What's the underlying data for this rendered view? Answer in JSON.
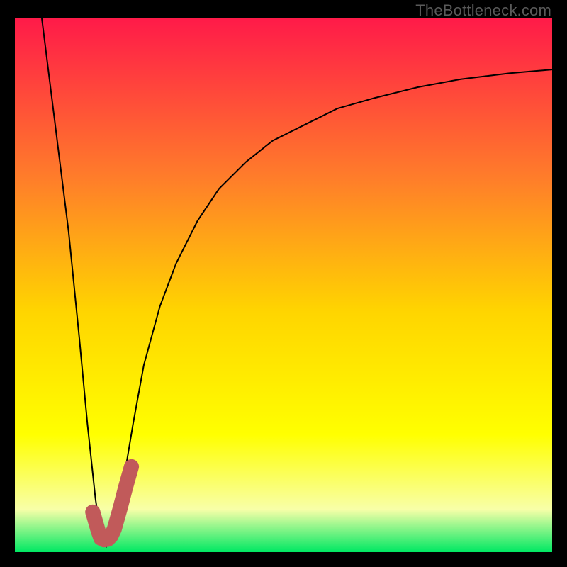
{
  "watermark": "TheBottleneck.com",
  "colors": {
    "frame": "#000000",
    "gradient_top": "#ff1a49",
    "gradient_mid1": "#ff7d2a",
    "gradient_mid2": "#ffd500",
    "gradient_mid3": "#ffff00",
    "gradient_low": "#f8ffa8",
    "gradient_bottom": "#00e863",
    "curve": "#000000",
    "marker_stroke": "#c15a5a",
    "marker_fill": "#c15a5a"
  },
  "chart_data": {
    "type": "line",
    "title": "",
    "xlabel": "",
    "ylabel": "",
    "xlim": [
      0,
      100
    ],
    "ylim": [
      0,
      100
    ],
    "series": [
      {
        "name": "bottleneck-curve",
        "x": [
          5,
          7.5,
          10,
          12,
          13.5,
          15,
          16,
          17,
          18,
          20,
          22,
          24,
          27,
          30,
          34,
          38,
          43,
          48,
          54,
          60,
          67,
          75,
          83,
          92,
          100
        ],
        "y": [
          100,
          80,
          60,
          40,
          24,
          10,
          3,
          1,
          3,
          12,
          24,
          35,
          46,
          54,
          62,
          68,
          73,
          77,
          80,
          83,
          85,
          87,
          88.5,
          89.6,
          90.3
        ]
      }
    ],
    "marker": {
      "name": "current-config",
      "path_x": [
        14.5,
        15.5,
        16.0,
        16.6,
        17.3,
        17.9,
        18.5,
        19.6,
        20.6,
        21.7
      ],
      "path_y": [
        7.5,
        4.0,
        2.6,
        2.3,
        2.4,
        3.0,
        4.3,
        8.2,
        12.1,
        16.0
      ],
      "dot": {
        "x": 14.5,
        "y": 7.5,
        "r": 1.4
      },
      "stroke_width": 2.8
    }
  }
}
